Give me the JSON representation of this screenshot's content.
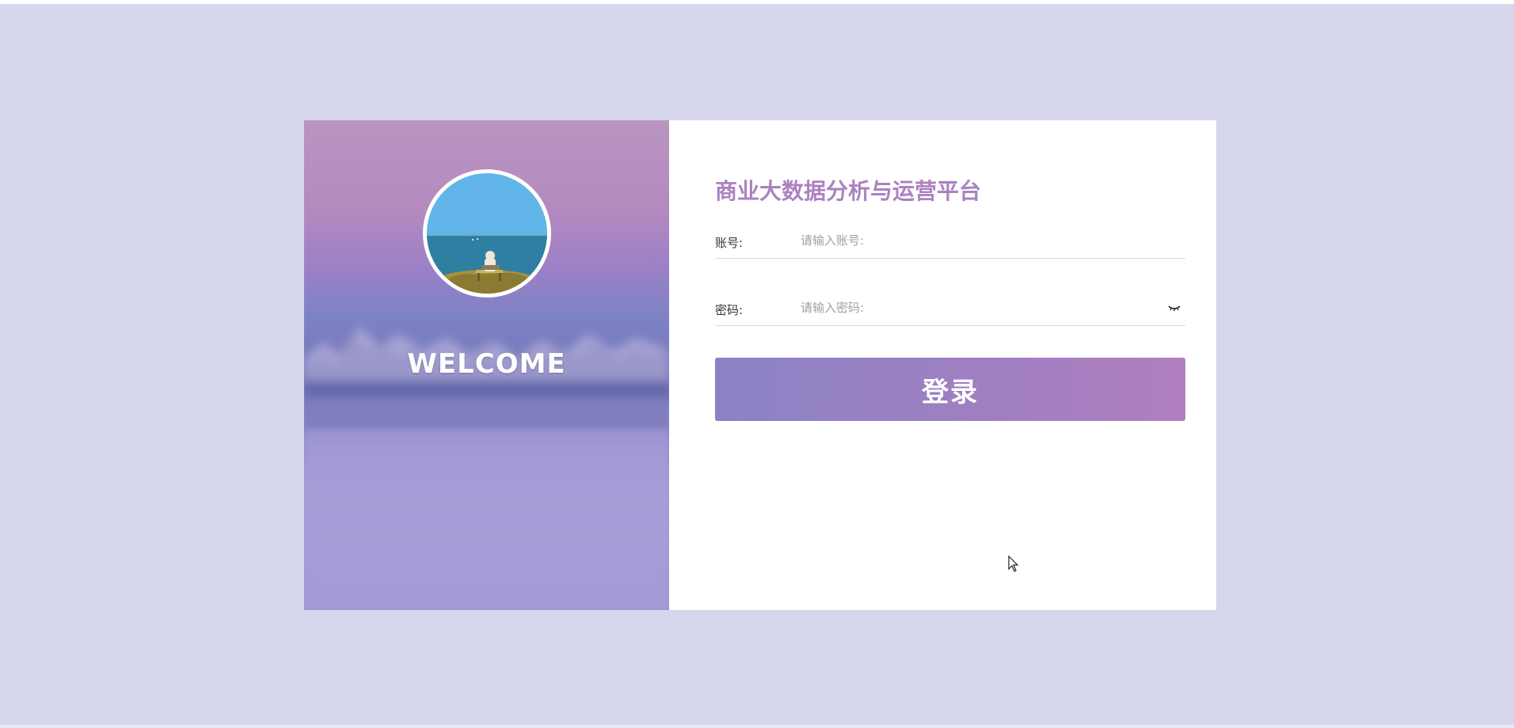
{
  "welcome_panel": {
    "heading": "WELCOME",
    "avatar_icon": "avatar-photo-icon"
  },
  "login_form": {
    "title": "商业大数据分析与运营平台",
    "account": {
      "label": "账号:",
      "placeholder": "请输入账号:",
      "value": ""
    },
    "password": {
      "label": "密码:",
      "placeholder": "请输入密码:",
      "value": "",
      "toggle_icon": "eye-closed-icon"
    },
    "submit_label": "登录"
  },
  "colors": {
    "page_background": "#d6d6ec",
    "title": "#ab82c0",
    "button_start": "#8b83c5",
    "button_end": "#b17fc0",
    "panel_background": "#ffffff"
  }
}
